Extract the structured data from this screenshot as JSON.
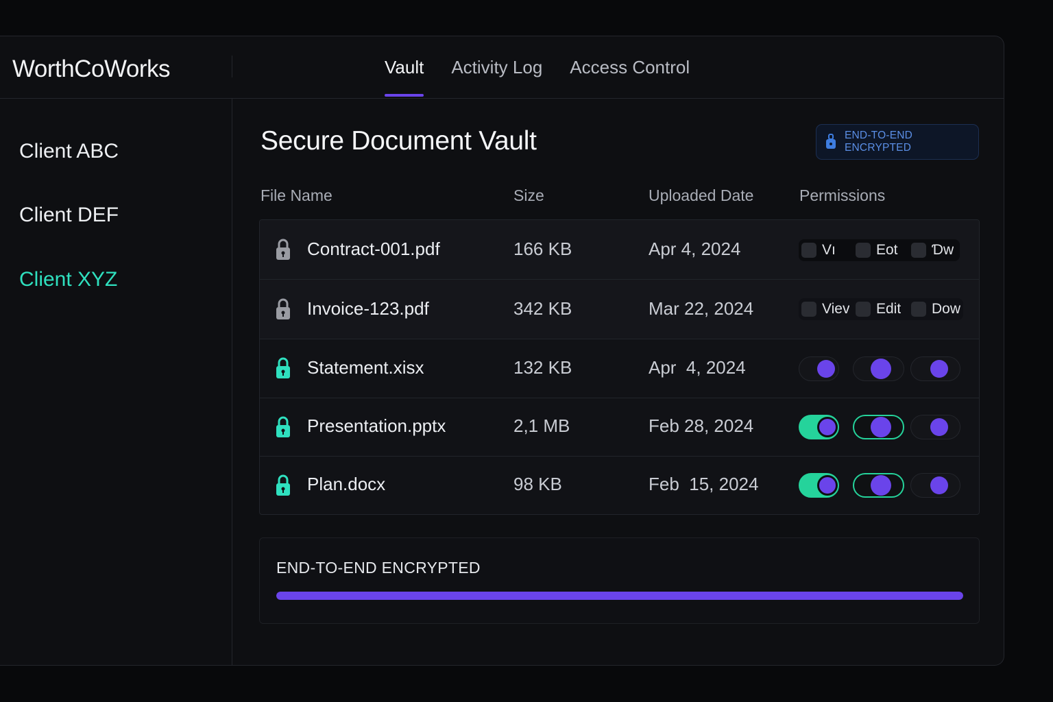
{
  "app": {
    "brand": "WorthCoWorks"
  },
  "tabs": [
    {
      "label": "Vault",
      "active": true
    },
    {
      "label": "Activity Log",
      "active": false
    },
    {
      "label": "Access Control",
      "active": false
    }
  ],
  "sidebar": {
    "items": [
      {
        "label": "Client ABC",
        "active": false
      },
      {
        "label": "Client DEF",
        "active": false
      },
      {
        "label": "Client XYZ",
        "active": true
      }
    ]
  },
  "main": {
    "title": "Secure Document Vault",
    "badge": {
      "label": "END-TO-END ENCRYPTED",
      "icon": "lock-icon"
    }
  },
  "table": {
    "headers": {
      "file_name": "File Name",
      "size": "Size",
      "uploaded": "Uploaded Date",
      "permissions": "Permissions"
    },
    "rows": [
      {
        "name": "Contract-001.pdf",
        "size": "166 KB",
        "date": "Apr 4, 2024",
        "lock_color": "#9a9ca3",
        "perm_labels": [
          "Vı",
          "Eot",
          "Ɗw"
        ]
      },
      {
        "name": "Invoice-123.pdf",
        "size": "342 KB",
        "date": "Mar 22, 2024",
        "lock_color": "#9a9ca3",
        "perm_labels": [
          "Viev",
          "Edit",
          "Dow"
        ]
      },
      {
        "name": "Statement.xisx",
        "size": "132 KB",
        "date": "Apr  4, 2024",
        "lock_color": "#2fe0bf"
      },
      {
        "name": "Presentation.pptx",
        "size": "2,1 MB",
        "date": "Feb 28, 2024",
        "lock_color": "#2fe0bf"
      },
      {
        "name": "Plan.docx",
        "size": "98 KB",
        "date": "Feb  15, 2024",
        "lock_color": "#2fe0bf"
      }
    ]
  },
  "encryption_progress": {
    "label": "END-TO-END ENCRYPTED",
    "fraction": 1.0
  },
  "colors": {
    "accent": "#6a44ea",
    "teal": "#2fe0bf",
    "toggle_on": "#25d39b",
    "badge_text": "#5b8fe6"
  }
}
